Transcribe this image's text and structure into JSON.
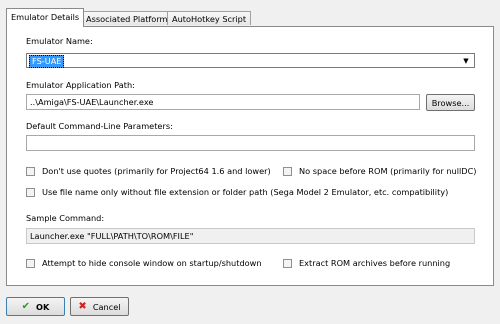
{
  "tabs": [
    "Emulator Details",
    "Associated Platforms",
    "AutoHotkey Script"
  ],
  "emulator_name": {
    "label": "Emulator Name:",
    "value": "FS-UAE"
  },
  "app_path": {
    "label": "Emulator Application Path:",
    "value": "..\\Amiga\\FS-UAE\\Launcher.exe",
    "browse_label": "Browse..."
  },
  "params": {
    "label": "Default Command-Line Parameters:",
    "value": ""
  },
  "options": {
    "no_quotes": "Don't use quotes (primarily for Project64 1.6 and lower)",
    "no_space": "No space before ROM (primarily for nullDC)",
    "file_name_only": "Use file name only without file extension or folder path (Sega Model 2 Emulator, etc. compatibility)"
  },
  "sample": {
    "label": "Sample Command:",
    "value": "Launcher.exe \"FULL\\PATH\\TO\\ROM\\FILE\""
  },
  "bottom_options": {
    "hide_console": "Attempt to hide console window on startup/shutdown",
    "extract_rom": "Extract ROM archives before running"
  },
  "buttons": {
    "ok": "OK",
    "cancel": "Cancel"
  },
  "colors": {
    "ok_check": "#2a9a2a",
    "cancel_x": "#d02020",
    "selection": "#3399ff"
  }
}
